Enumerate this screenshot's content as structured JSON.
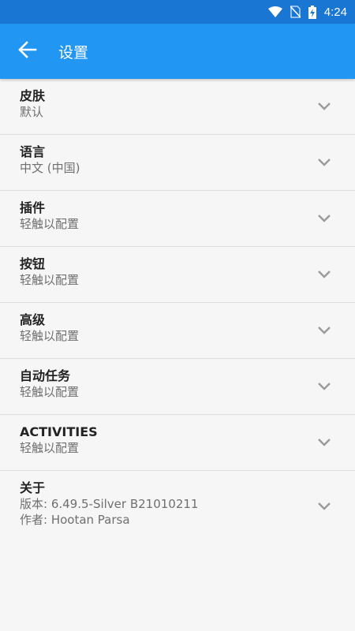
{
  "status_bar": {
    "time": "4:24"
  },
  "app_bar": {
    "title": "设置"
  },
  "settings": [
    {
      "title": "皮肤",
      "lines": [
        "默认"
      ]
    },
    {
      "title": "语言",
      "lines": [
        "中文 (中国)"
      ]
    },
    {
      "title": "插件",
      "lines": [
        "轻触以配置"
      ]
    },
    {
      "title": "按钮",
      "lines": [
        "轻触以配置"
      ]
    },
    {
      "title": "高级",
      "lines": [
        "轻触以配置"
      ]
    },
    {
      "title": "自动任务",
      "lines": [
        "轻触以配置"
      ]
    },
    {
      "title": "ACTIVITIES",
      "lines": [
        "轻触以配置"
      ]
    },
    {
      "title": "关于",
      "lines": [
        "版本: 6.49.5-Silver  B21010211",
        "作者: Hootan Parsa"
      ]
    }
  ],
  "colors": {
    "status_bar": "#1976d2",
    "app_bar": "#2196f3",
    "background": "#f6f6f6"
  },
  "icons": {
    "back": "arrow-back-icon",
    "expand": "chevron-down-icon"
  }
}
